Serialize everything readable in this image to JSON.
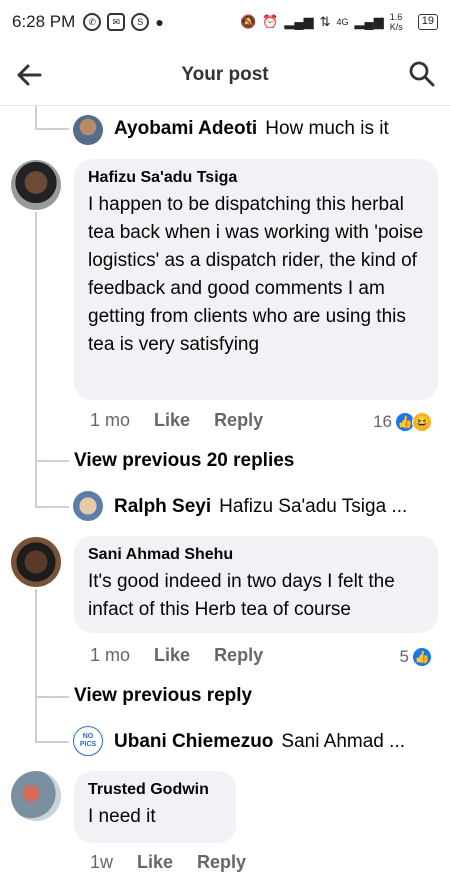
{
  "status_bar": {
    "time": "6:28 PM",
    "network": "4G",
    "speed": "1.6 K/s",
    "battery": "19"
  },
  "header": {
    "title": "Your post"
  },
  "colors": {
    "like_blue": "#1877f2",
    "bubble_bg": "#f0f2f5",
    "meta_gray": "#65676b"
  },
  "thread": {
    "top_reply": {
      "name": "Ayobami Adeoti",
      "text": "How much is it"
    },
    "comments": [
      {
        "name": "Hafizu Sa'adu Tsiga",
        "text": "I happen to be dispatching this herbal tea back when i was working with 'poise logistics' as a dispatch rider,  the kind of feedback and good comments I am getting from clients who are using this tea is very satisfying",
        "time": "1 mo",
        "like": "Like",
        "reply": "Reply",
        "reactions_count": "16",
        "view_previous": "View previous 20 replies",
        "latest_reply": {
          "name": "Ralph Seyi",
          "text": "Hafizu Sa'adu Tsiga ..."
        }
      },
      {
        "name": "Sani Ahmad Shehu",
        "text": "It's good indeed in two days I felt the infact of this Herb tea of course",
        "time": "1 mo",
        "like": "Like",
        "reply": "Reply",
        "reactions_count": "5",
        "view_previous": "View previous reply",
        "latest_reply": {
          "name": "Ubani Chiemezuo",
          "text": "Sani Ahmad ...",
          "avatar_text": "NO PICS"
        }
      },
      {
        "name": "Trusted Godwin",
        "text": "I need it",
        "time": "1w",
        "like": "Like",
        "reply": "Reply"
      }
    ]
  }
}
